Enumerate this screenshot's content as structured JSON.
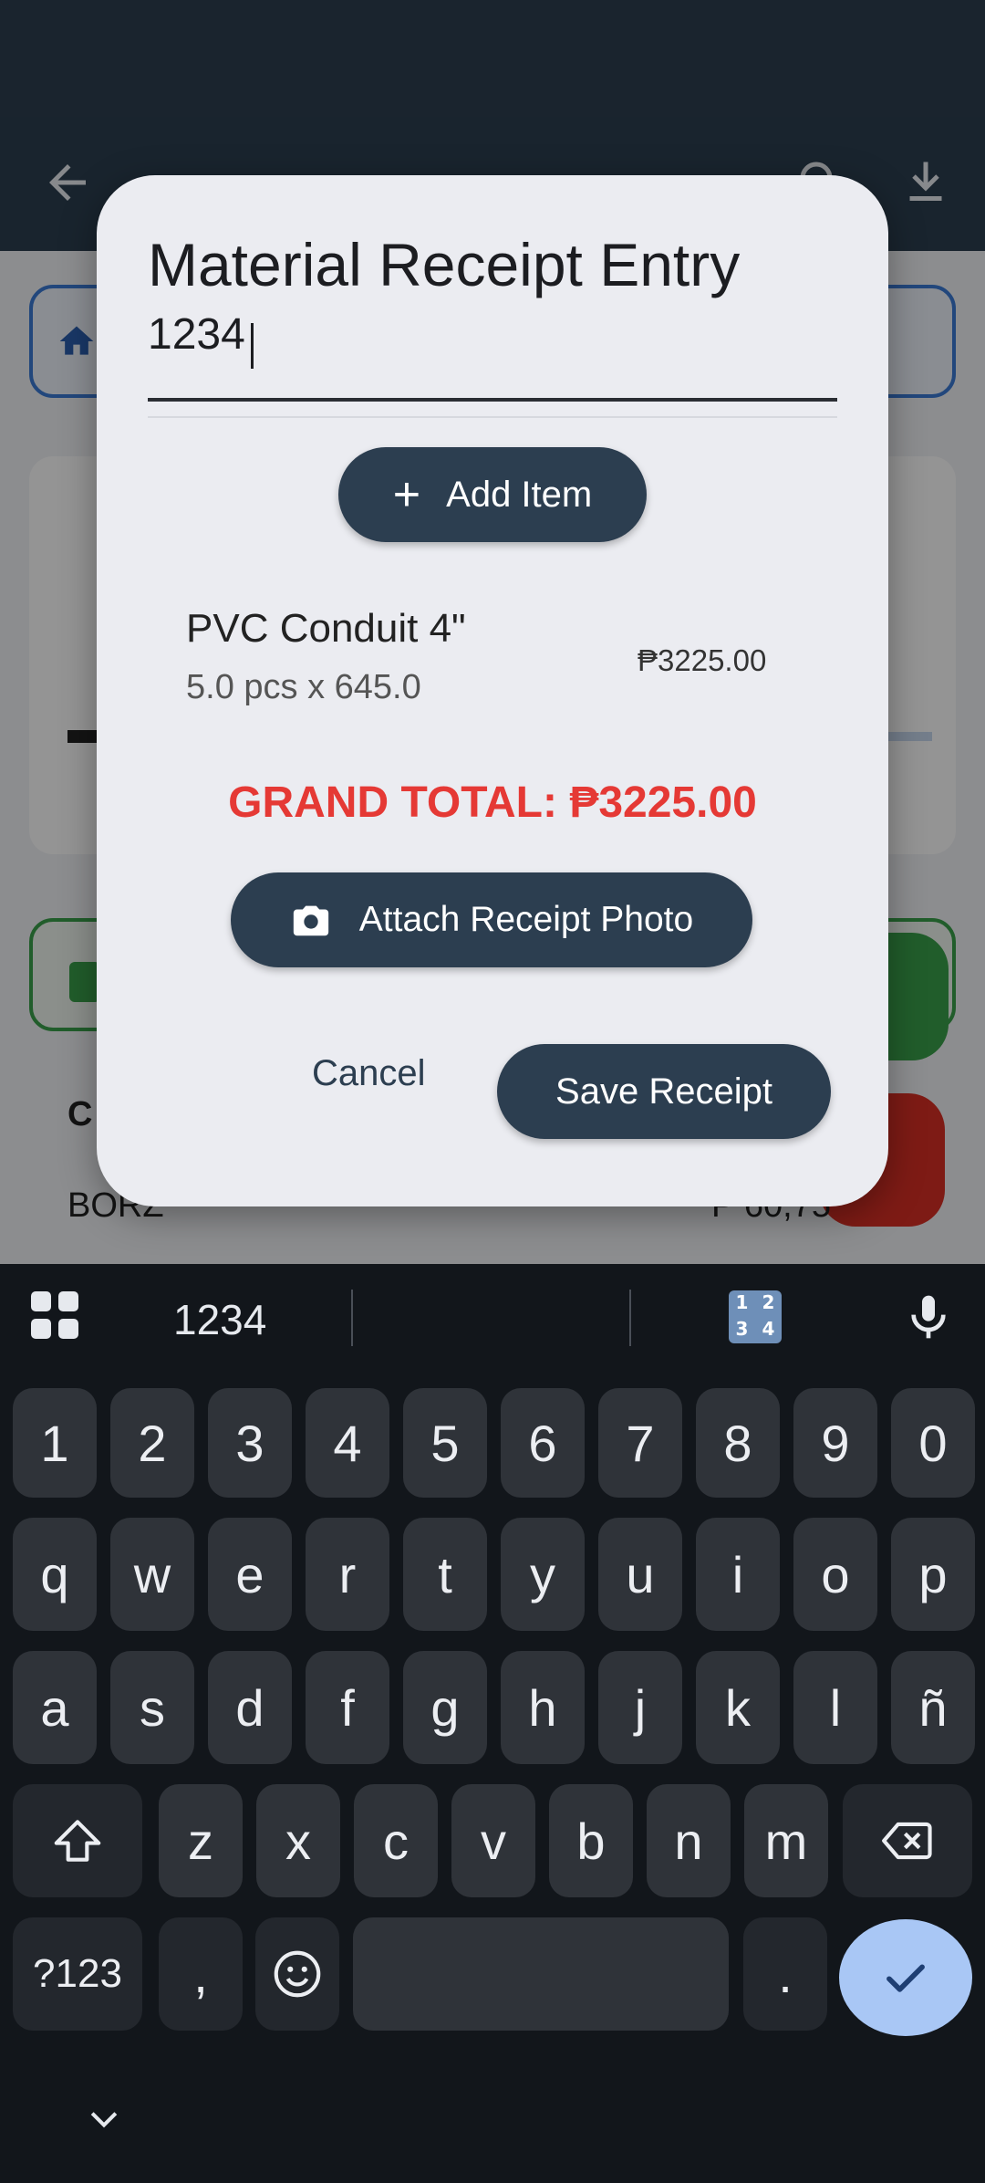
{
  "app": {
    "header": {
      "back_icon": "arrow-left-icon",
      "search_icon": "search-icon",
      "download_icon": "download-icon"
    },
    "background_row_label": "C",
    "background_row_text": "BORZ",
    "background_row_amount": "₱ 60,75"
  },
  "dialog": {
    "title": "Material Receipt Entry",
    "input_value": "1234",
    "add_item_label": "Add Item",
    "item": {
      "name": "PVC Conduit 4\"",
      "detail": "5.0 pcs x 645.0",
      "price": "₱3225.00"
    },
    "grand_total": "GRAND TOTAL: ₱3225.00",
    "attach_label": "Attach Receipt Photo",
    "cancel_label": "Cancel",
    "save_label": "Save Receipt"
  },
  "keyboard": {
    "suggestion": "1234",
    "numpad_glyphs": [
      "1",
      "2",
      "3",
      "4"
    ],
    "row_numbers": [
      "1",
      "2",
      "3",
      "4",
      "5",
      "6",
      "7",
      "8",
      "9",
      "0"
    ],
    "row_top": [
      "q",
      "w",
      "e",
      "r",
      "t",
      "y",
      "u",
      "i",
      "o",
      "p"
    ],
    "row_middle": [
      "a",
      "s",
      "d",
      "f",
      "g",
      "h",
      "j",
      "k",
      "l",
      "ñ"
    ],
    "row_bottom": [
      "z",
      "x",
      "c",
      "v",
      "b",
      "n",
      "m"
    ],
    "symbols_label": "?123",
    "comma_label": ",",
    "period_label": "."
  },
  "colors": {
    "primary": "#2c3e50",
    "total_red": "#e53935",
    "enter_key": "#a9c7f5"
  }
}
